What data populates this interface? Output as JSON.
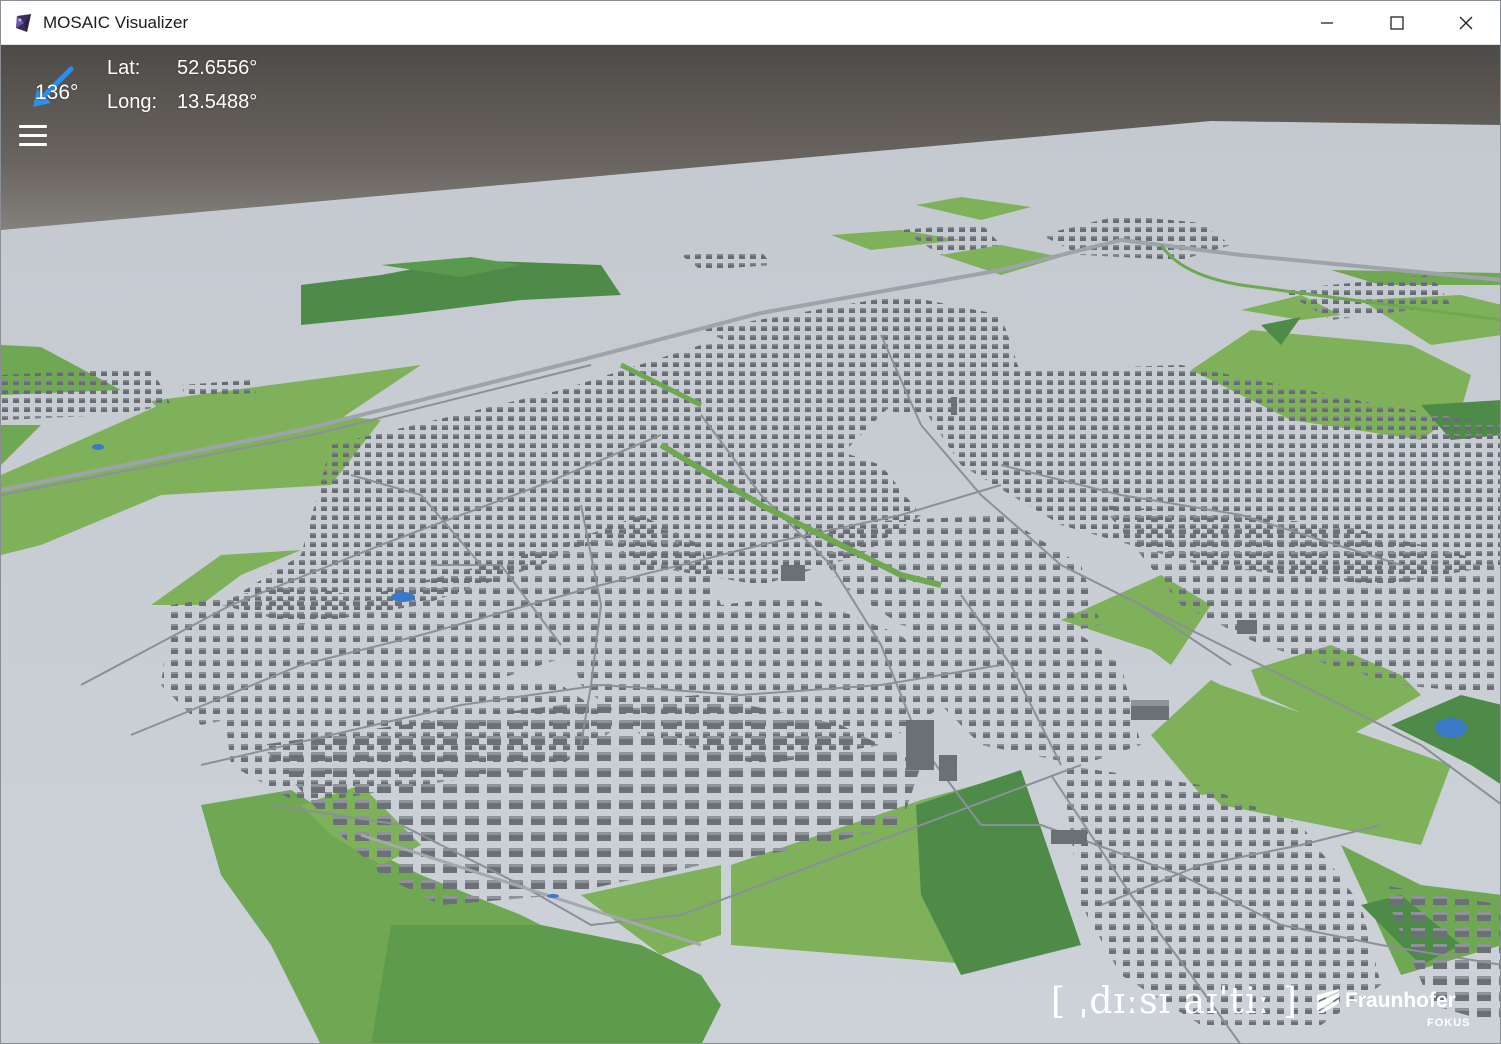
{
  "window": {
    "title": "MOSAIC Visualizer",
    "controls": {
      "minimize": "minimize",
      "maximize": "maximize",
      "close": "close"
    }
  },
  "hud": {
    "heading": "136°",
    "lat_label": "Lat:",
    "lat_value": "52.6556°",
    "long_label": "Long:",
    "long_value": "13.5488°"
  },
  "logos": {
    "dissertation": "[ ˌdɪːsɪ aɪˈtiː ]",
    "fraunhofer_name": "Fraunhofer",
    "fraunhofer_institute": "FOKUS"
  },
  "icons": {
    "app": "mosaic-app-icon",
    "compass": "compass-arrow-icon",
    "menu": "hamburger-menu-icon"
  },
  "colors": {
    "ground": "#c7ccd3",
    "field_light": "#7fb15b",
    "field_dark": "#4e8a48",
    "building": "#6d7279",
    "road": "#8e939a",
    "water": "#3a78c8",
    "sky": "#5a5550"
  }
}
